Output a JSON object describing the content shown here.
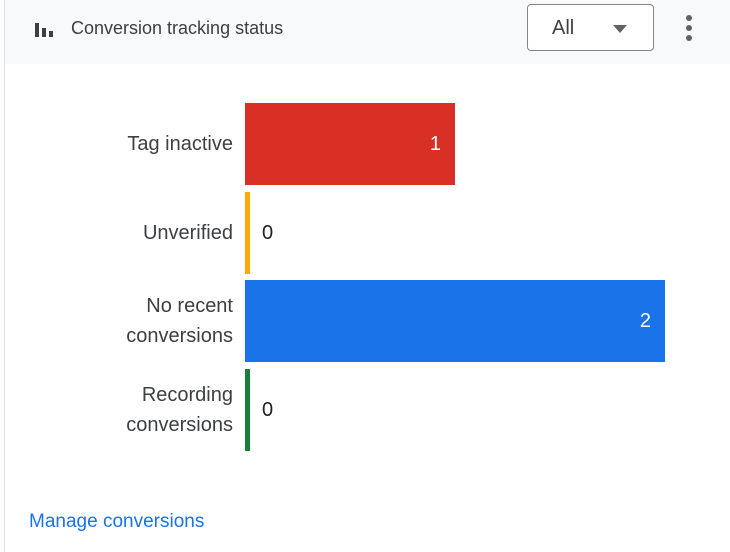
{
  "header": {
    "title": "Conversion tracking status",
    "icon": "bar-chart-icon",
    "filter": {
      "selected": "All"
    },
    "menu_icon": "more-vert-icon"
  },
  "chart_data": {
    "type": "bar",
    "orientation": "horizontal",
    "categories": [
      "Tag inactive",
      "Unverified",
      "No recent conversions",
      "Recording conversions"
    ],
    "category_lines": [
      [
        "Tag inactive"
      ],
      [
        "Unverified"
      ],
      [
        "No recent",
        "conversions"
      ],
      [
        "Recording",
        "conversions"
      ]
    ],
    "values": [
      1,
      0,
      2,
      0
    ],
    "value_labels": [
      "1",
      "0",
      "2",
      "0"
    ],
    "colors": [
      "#d93025",
      "#f9ab00",
      "#1a73e8",
      "#188038"
    ],
    "xlim": [
      0,
      2
    ]
  },
  "footer": {
    "link_label": "Manage conversions"
  }
}
